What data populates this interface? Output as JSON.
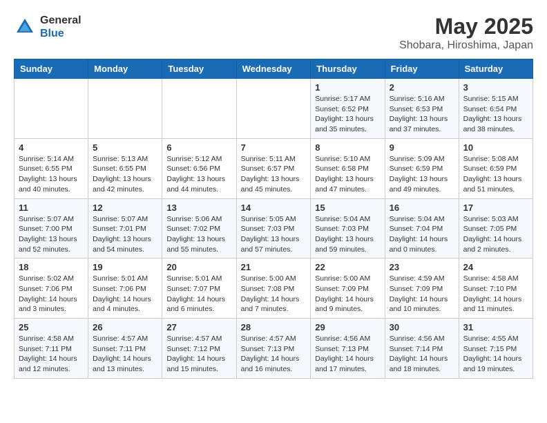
{
  "header": {
    "logo_line1": "General",
    "logo_line2": "Blue",
    "month_year": "May 2025",
    "location": "Shobara, Hiroshima, Japan"
  },
  "days_of_week": [
    "Sunday",
    "Monday",
    "Tuesday",
    "Wednesday",
    "Thursday",
    "Friday",
    "Saturday"
  ],
  "weeks": [
    [
      {
        "day": "",
        "sunrise": "",
        "sunset": "",
        "daylight": ""
      },
      {
        "day": "",
        "sunrise": "",
        "sunset": "",
        "daylight": ""
      },
      {
        "day": "",
        "sunrise": "",
        "sunset": "",
        "daylight": ""
      },
      {
        "day": "",
        "sunrise": "",
        "sunset": "",
        "daylight": ""
      },
      {
        "day": "1",
        "sunrise": "Sunrise: 5:17 AM",
        "sunset": "Sunset: 6:52 PM",
        "daylight": "Daylight: 13 hours and 35 minutes."
      },
      {
        "day": "2",
        "sunrise": "Sunrise: 5:16 AM",
        "sunset": "Sunset: 6:53 PM",
        "daylight": "Daylight: 13 hours and 37 minutes."
      },
      {
        "day": "3",
        "sunrise": "Sunrise: 5:15 AM",
        "sunset": "Sunset: 6:54 PM",
        "daylight": "Daylight: 13 hours and 38 minutes."
      }
    ],
    [
      {
        "day": "4",
        "sunrise": "Sunrise: 5:14 AM",
        "sunset": "Sunset: 6:55 PM",
        "daylight": "Daylight: 13 hours and 40 minutes."
      },
      {
        "day": "5",
        "sunrise": "Sunrise: 5:13 AM",
        "sunset": "Sunset: 6:55 PM",
        "daylight": "Daylight: 13 hours and 42 minutes."
      },
      {
        "day": "6",
        "sunrise": "Sunrise: 5:12 AM",
        "sunset": "Sunset: 6:56 PM",
        "daylight": "Daylight: 13 hours and 44 minutes."
      },
      {
        "day": "7",
        "sunrise": "Sunrise: 5:11 AM",
        "sunset": "Sunset: 6:57 PM",
        "daylight": "Daylight: 13 hours and 45 minutes."
      },
      {
        "day": "8",
        "sunrise": "Sunrise: 5:10 AM",
        "sunset": "Sunset: 6:58 PM",
        "daylight": "Daylight: 13 hours and 47 minutes."
      },
      {
        "day": "9",
        "sunrise": "Sunrise: 5:09 AM",
        "sunset": "Sunset: 6:59 PM",
        "daylight": "Daylight: 13 hours and 49 minutes."
      },
      {
        "day": "10",
        "sunrise": "Sunrise: 5:08 AM",
        "sunset": "Sunset: 6:59 PM",
        "daylight": "Daylight: 13 hours and 51 minutes."
      }
    ],
    [
      {
        "day": "11",
        "sunrise": "Sunrise: 5:07 AM",
        "sunset": "Sunset: 7:00 PM",
        "daylight": "Daylight: 13 hours and 52 minutes."
      },
      {
        "day": "12",
        "sunrise": "Sunrise: 5:07 AM",
        "sunset": "Sunset: 7:01 PM",
        "daylight": "Daylight: 13 hours and 54 minutes."
      },
      {
        "day": "13",
        "sunrise": "Sunrise: 5:06 AM",
        "sunset": "Sunset: 7:02 PM",
        "daylight": "Daylight: 13 hours and 55 minutes."
      },
      {
        "day": "14",
        "sunrise": "Sunrise: 5:05 AM",
        "sunset": "Sunset: 7:03 PM",
        "daylight": "Daylight: 13 hours and 57 minutes."
      },
      {
        "day": "15",
        "sunrise": "Sunrise: 5:04 AM",
        "sunset": "Sunset: 7:03 PM",
        "daylight": "Daylight: 13 hours and 59 minutes."
      },
      {
        "day": "16",
        "sunrise": "Sunrise: 5:04 AM",
        "sunset": "Sunset: 7:04 PM",
        "daylight": "Daylight: 14 hours and 0 minutes."
      },
      {
        "day": "17",
        "sunrise": "Sunrise: 5:03 AM",
        "sunset": "Sunset: 7:05 PM",
        "daylight": "Daylight: 14 hours and 2 minutes."
      }
    ],
    [
      {
        "day": "18",
        "sunrise": "Sunrise: 5:02 AM",
        "sunset": "Sunset: 7:06 PM",
        "daylight": "Daylight: 14 hours and 3 minutes."
      },
      {
        "day": "19",
        "sunrise": "Sunrise: 5:01 AM",
        "sunset": "Sunset: 7:06 PM",
        "daylight": "Daylight: 14 hours and 4 minutes."
      },
      {
        "day": "20",
        "sunrise": "Sunrise: 5:01 AM",
        "sunset": "Sunset: 7:07 PM",
        "daylight": "Daylight: 14 hours and 6 minutes."
      },
      {
        "day": "21",
        "sunrise": "Sunrise: 5:00 AM",
        "sunset": "Sunset: 7:08 PM",
        "daylight": "Daylight: 14 hours and 7 minutes."
      },
      {
        "day": "22",
        "sunrise": "Sunrise: 5:00 AM",
        "sunset": "Sunset: 7:09 PM",
        "daylight": "Daylight: 14 hours and 9 minutes."
      },
      {
        "day": "23",
        "sunrise": "Sunrise: 4:59 AM",
        "sunset": "Sunset: 7:09 PM",
        "daylight": "Daylight: 14 hours and 10 minutes."
      },
      {
        "day": "24",
        "sunrise": "Sunrise: 4:58 AM",
        "sunset": "Sunset: 7:10 PM",
        "daylight": "Daylight: 14 hours and 11 minutes."
      }
    ],
    [
      {
        "day": "25",
        "sunrise": "Sunrise: 4:58 AM",
        "sunset": "Sunset: 7:11 PM",
        "daylight": "Daylight: 14 hours and 12 minutes."
      },
      {
        "day": "26",
        "sunrise": "Sunrise: 4:57 AM",
        "sunset": "Sunset: 7:11 PM",
        "daylight": "Daylight: 14 hours and 13 minutes."
      },
      {
        "day": "27",
        "sunrise": "Sunrise: 4:57 AM",
        "sunset": "Sunset: 7:12 PM",
        "daylight": "Daylight: 14 hours and 15 minutes."
      },
      {
        "day": "28",
        "sunrise": "Sunrise: 4:57 AM",
        "sunset": "Sunset: 7:13 PM",
        "daylight": "Daylight: 14 hours and 16 minutes."
      },
      {
        "day": "29",
        "sunrise": "Sunrise: 4:56 AM",
        "sunset": "Sunset: 7:13 PM",
        "daylight": "Daylight: 14 hours and 17 minutes."
      },
      {
        "day": "30",
        "sunrise": "Sunrise: 4:56 AM",
        "sunset": "Sunset: 7:14 PM",
        "daylight": "Daylight: 14 hours and 18 minutes."
      },
      {
        "day": "31",
        "sunrise": "Sunrise: 4:55 AM",
        "sunset": "Sunset: 7:15 PM",
        "daylight": "Daylight: 14 hours and 19 minutes."
      }
    ]
  ]
}
